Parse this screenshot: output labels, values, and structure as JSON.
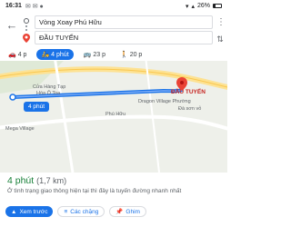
{
  "status": {
    "time": "16:31",
    "battery": "26%"
  },
  "route": {
    "origin": "Vòng Xoay Phú Hữu",
    "destination": "ĐẦU TUYẾN"
  },
  "modes": [
    {
      "icon": "car-icon",
      "label": "4 p"
    },
    {
      "icon": "motorbike-icon",
      "label": "4 phút",
      "active": true
    },
    {
      "icon": "bus-icon",
      "label": "23 p"
    },
    {
      "icon": "walk-icon",
      "label": "20 p"
    }
  ],
  "map": {
    "eta_bubble": "4 phút",
    "dest_label": "ĐẦU TUYẾN",
    "labels": [
      "Cửa Hàng Tạp",
      "Hóa Ô Toa",
      "Mega Village",
      "Dragon Village Phường",
      "Đà sơn vỏ",
      "Phú Hữu"
    ]
  },
  "summary": {
    "time": "4 phút",
    "distance": "(1,7 km)",
    "note": "Ở tình trạng giao thông hiện tại thì đây là tuyến đường nhanh nhất"
  },
  "actions": {
    "preview": "Xem trước",
    "stops": "Các chặng",
    "pin": "Ghim"
  },
  "colors": {
    "accent": "#1a73e8",
    "route_line": "#4285f4",
    "destination_pin": "#ea4335",
    "eta_green": "#188038"
  }
}
